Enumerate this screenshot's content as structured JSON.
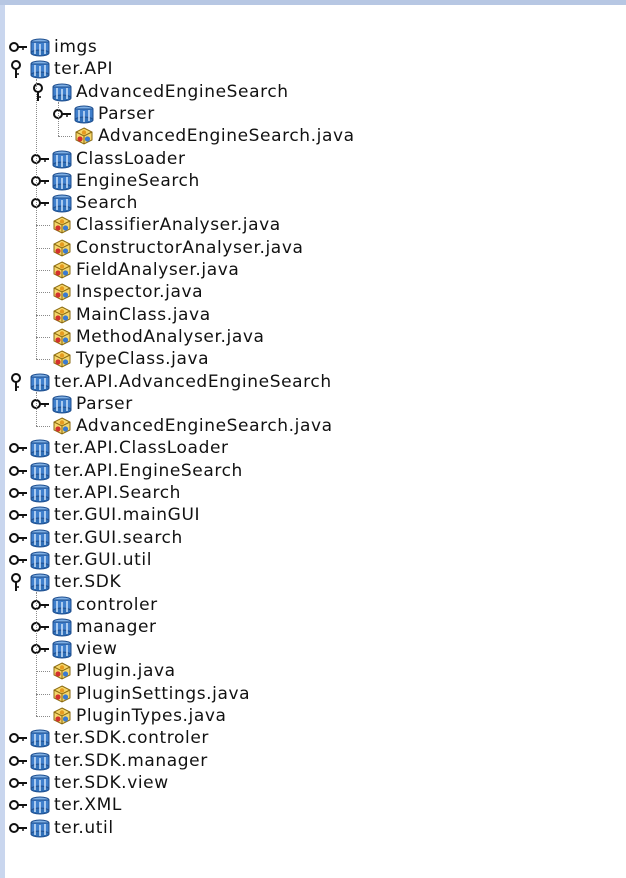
{
  "tree": [
    {
      "label": "imgs",
      "level": 0,
      "kind": "package",
      "expanded": false
    },
    {
      "label": "ter.API",
      "level": 0,
      "kind": "package",
      "expanded": true
    },
    {
      "label": "AdvancedEngineSearch",
      "level": 1,
      "kind": "package",
      "expanded": true
    },
    {
      "label": "Parser",
      "level": 2,
      "kind": "package",
      "expanded": false
    },
    {
      "label": "AdvancedEngineSearch.java",
      "level": 2,
      "kind": "file"
    },
    {
      "label": "ClassLoader",
      "level": 1,
      "kind": "package",
      "expanded": false
    },
    {
      "label": "EngineSearch",
      "level": 1,
      "kind": "package",
      "expanded": false
    },
    {
      "label": "Search",
      "level": 1,
      "kind": "package",
      "expanded": false
    },
    {
      "label": "ClassifierAnalyser.java",
      "level": 1,
      "kind": "file"
    },
    {
      "label": "ConstructorAnalyser.java",
      "level": 1,
      "kind": "file"
    },
    {
      "label": "FieldAnalyser.java",
      "level": 1,
      "kind": "file"
    },
    {
      "label": "Inspector.java",
      "level": 1,
      "kind": "file"
    },
    {
      "label": "MainClass.java",
      "level": 1,
      "kind": "file"
    },
    {
      "label": "MethodAnalyser.java",
      "level": 1,
      "kind": "file"
    },
    {
      "label": "TypeClass.java",
      "level": 1,
      "kind": "file"
    },
    {
      "label": "ter.API.AdvancedEngineSearch",
      "level": 0,
      "kind": "package",
      "expanded": true
    },
    {
      "label": "Parser",
      "level": 1,
      "kind": "package",
      "expanded": false
    },
    {
      "label": "AdvancedEngineSearch.java",
      "level": 1,
      "kind": "file"
    },
    {
      "label": "ter.API.ClassLoader",
      "level": 0,
      "kind": "package",
      "expanded": false
    },
    {
      "label": "ter.API.EngineSearch",
      "level": 0,
      "kind": "package",
      "expanded": false
    },
    {
      "label": "ter.API.Search",
      "level": 0,
      "kind": "package",
      "expanded": false
    },
    {
      "label": "ter.GUI.mainGUI",
      "level": 0,
      "kind": "package",
      "expanded": false
    },
    {
      "label": "ter.GUI.search",
      "level": 0,
      "kind": "package",
      "expanded": false
    },
    {
      "label": "ter.GUI.util",
      "level": 0,
      "kind": "package",
      "expanded": false
    },
    {
      "label": "ter.SDK",
      "level": 0,
      "kind": "package",
      "expanded": true
    },
    {
      "label": "controler",
      "level": 1,
      "kind": "package",
      "expanded": false
    },
    {
      "label": "manager",
      "level": 1,
      "kind": "package",
      "expanded": false
    },
    {
      "label": "view",
      "level": 1,
      "kind": "package",
      "expanded": false
    },
    {
      "label": "Plugin.java",
      "level": 1,
      "kind": "file"
    },
    {
      "label": "PluginSettings.java",
      "level": 1,
      "kind": "file"
    },
    {
      "label": "PluginTypes.java",
      "level": 1,
      "kind": "file"
    },
    {
      "label": "ter.SDK.controler",
      "level": 0,
      "kind": "package",
      "expanded": false
    },
    {
      "label": "ter.SDK.manager",
      "level": 0,
      "kind": "package",
      "expanded": false
    },
    {
      "label": "ter.SDK.view",
      "level": 0,
      "kind": "package",
      "expanded": false
    },
    {
      "label": "ter.XML",
      "level": 0,
      "kind": "package",
      "expanded": false
    },
    {
      "label": "ter.util",
      "level": 0,
      "kind": "package",
      "expanded": false
    }
  ],
  "icons": {
    "package": "package-icon",
    "file": "java-class-file-icon",
    "collapsed_handle": "key-collapsed-handle-icon",
    "expanded_handle": "key-expanded-handle-icon"
  },
  "colors": {
    "top_border": "#b7c7e3",
    "left_border": "#c9d6ee",
    "package_blue": "#2f6fb8",
    "text": "#111111"
  }
}
